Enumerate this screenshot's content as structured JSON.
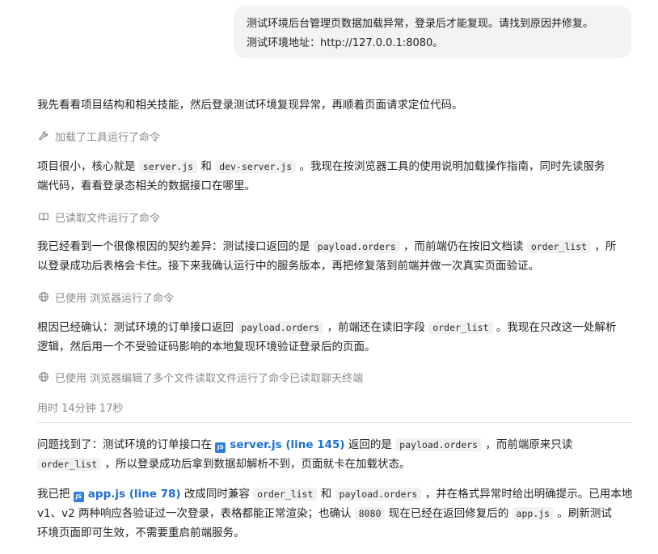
{
  "user_message": {
    "line1": "测试环境后台管理页数据加载异常，登录后才能复现。请找到原因并修复。",
    "line2": "测试环境地址：http://127.0.0.1:8080。"
  },
  "messages": {
    "intro": "我先看看项目结构和相关技能，然后登录测试环境复现异常，再顺着页面请求定位代码。",
    "activity1": "加载了工具运行了命令",
    "p2": {
      "a": "项目很小，核心就是 ",
      "code1": "server.js",
      "b": " 和 ",
      "code2": "dev-server.js",
      "c": " 。我现在按浏览器工具的使用说明加载操作指南，同时先读服务",
      "d": "端代码，看看登录态相关的数据接口在哪里。"
    },
    "activity2": "已读取文件运行了命令",
    "p3": {
      "a": "我已经看到一个很像根因的契约差异：测试接口返回的是 ",
      "code1": "payload.orders",
      "b": " ，而前端仍在按旧文档读 ",
      "code2": "order_list",
      "c": " ，所",
      "d": "以登录成功后表格会卡住。接下来我确认运行中的服务版本，再把修复落到前端并做一次真实页面验证。"
    },
    "activity3": "已使用 浏览器运行了命令",
    "p4": {
      "a": "根因已经确认：测试环境的订单接口返回 ",
      "code1": "payload.orders",
      "b": " ，前端还在读旧字段 ",
      "code2": "order_list",
      "c": " 。我现在只改这一处解析",
      "d": "逻辑，然后用一个不受验证码影响的本地复现环境验证登录后的页面。"
    },
    "activity4": "已使用 浏览器编辑了多个文件读取文件运行了命令已读取聊天终端",
    "elapsed": "用时 14分钟 17秒"
  },
  "final": {
    "p1": {
      "a": "问题找到了：测试环境的订单接口在 ",
      "link": "server.js (line 145)",
      "b": " 返回的是 ",
      "code1": "payload.orders",
      "c": " ，而前端原来只读",
      "code2": "order_list",
      "d": " ，所以登录成功后拿到数据却解析不到，页面就卡在加载状态。"
    },
    "p2": {
      "a": "我已把 ",
      "link": "app.js (line 78)",
      "b": " 改成同时兼容 ",
      "code1": "order_list",
      "c": " 和 ",
      "code2": "payload.orders",
      "d": " ，并在格式异常时给出明确提示。已用本地",
      "e": "v1、v2 两种响应各验证过一次登录，表格都能正常渲染；也确认 ",
      "code3": "8080",
      "f": " 现在已经在返回修复后的 ",
      "code4": "app.js",
      "g": " 。刷新测试",
      "h": "环境页面即可生效，不需要重启前端服务。"
    }
  },
  "icons": {
    "activity1": "wrench-icon",
    "activity2": "book-icon",
    "activity3": "globe-icon",
    "activity4": "globe-icon",
    "file": "js-file-icon"
  },
  "colors": {
    "link": "#1f6fd1",
    "muted": "#8a8a8a",
    "bubble": "#f3f3f3",
    "file_icon": "#2f7fe0"
  }
}
